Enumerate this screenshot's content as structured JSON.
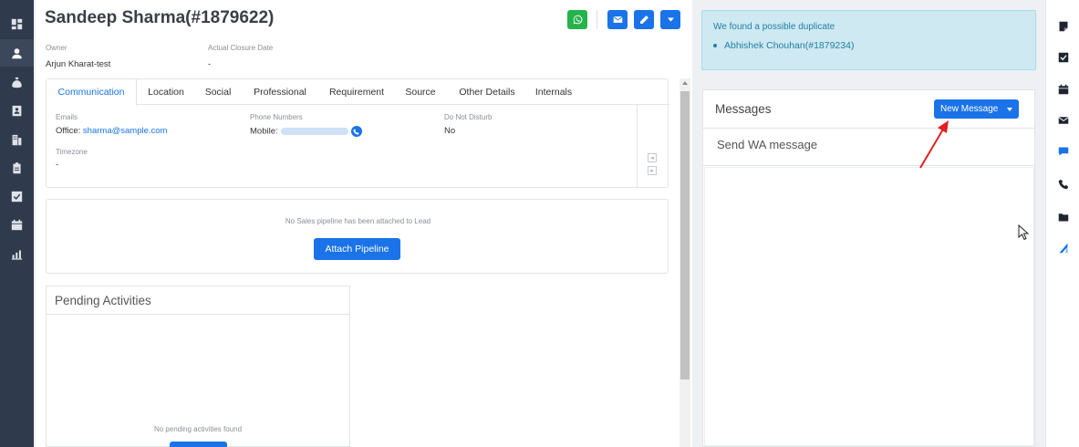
{
  "left_nav": {
    "icons": [
      "dashboard-icon",
      "person-icon",
      "money-bag-icon",
      "contact-card-icon",
      "building-icon",
      "clipboard-icon",
      "task-check-icon",
      "calendar-icon",
      "report-chart-icon"
    ]
  },
  "lead": {
    "title": "Sandeep Sharma(#1879622)",
    "owner_label": "Owner",
    "owner_value": "Arjun Kharat-test",
    "closure_label": "Actual Closure Date",
    "closure_value": "-"
  },
  "tabs": [
    "Communication",
    "Location",
    "Social",
    "Professional",
    "Requirement",
    "Source",
    "Other Details",
    "Internals"
  ],
  "communication": {
    "emails_label": "Emails",
    "email_prefix": "Office:",
    "email_value": "sharma@sample.com",
    "phones_label": "Phone Numbers",
    "phone_prefix": "Mobile:",
    "dnd_label": "Do Not Disturb",
    "dnd_value": "No",
    "timezone_label": "Timezone",
    "timezone_value": "-"
  },
  "pipeline": {
    "message": "No Sales pipeline has been attached to Lead",
    "button": "Attach Pipeline"
  },
  "activities": {
    "title": "Pending Activities",
    "empty_message": "No pending activities found"
  },
  "duplicate": {
    "title": "We found a possible duplicate",
    "item": "Abhishek Chouhan(#1879234)"
  },
  "messages": {
    "title": "Messages",
    "new_button": "New Message",
    "wa_option": "Send WA message"
  },
  "right_toolbar": {
    "icons": [
      "note-icon",
      "task-check-icon",
      "calendar-icon",
      "email-icon",
      "chat-icon",
      "phone-icon",
      "folder-icon",
      "pipeline-icon"
    ]
  },
  "colors": {
    "sidebar": "#2f3a4c",
    "primary": "#1a73e8",
    "whatsapp": "#25b34b",
    "alert_bg": "#cfe9f2",
    "alert_text": "#1e7fa6",
    "annotation_arrow": "#e02020"
  }
}
